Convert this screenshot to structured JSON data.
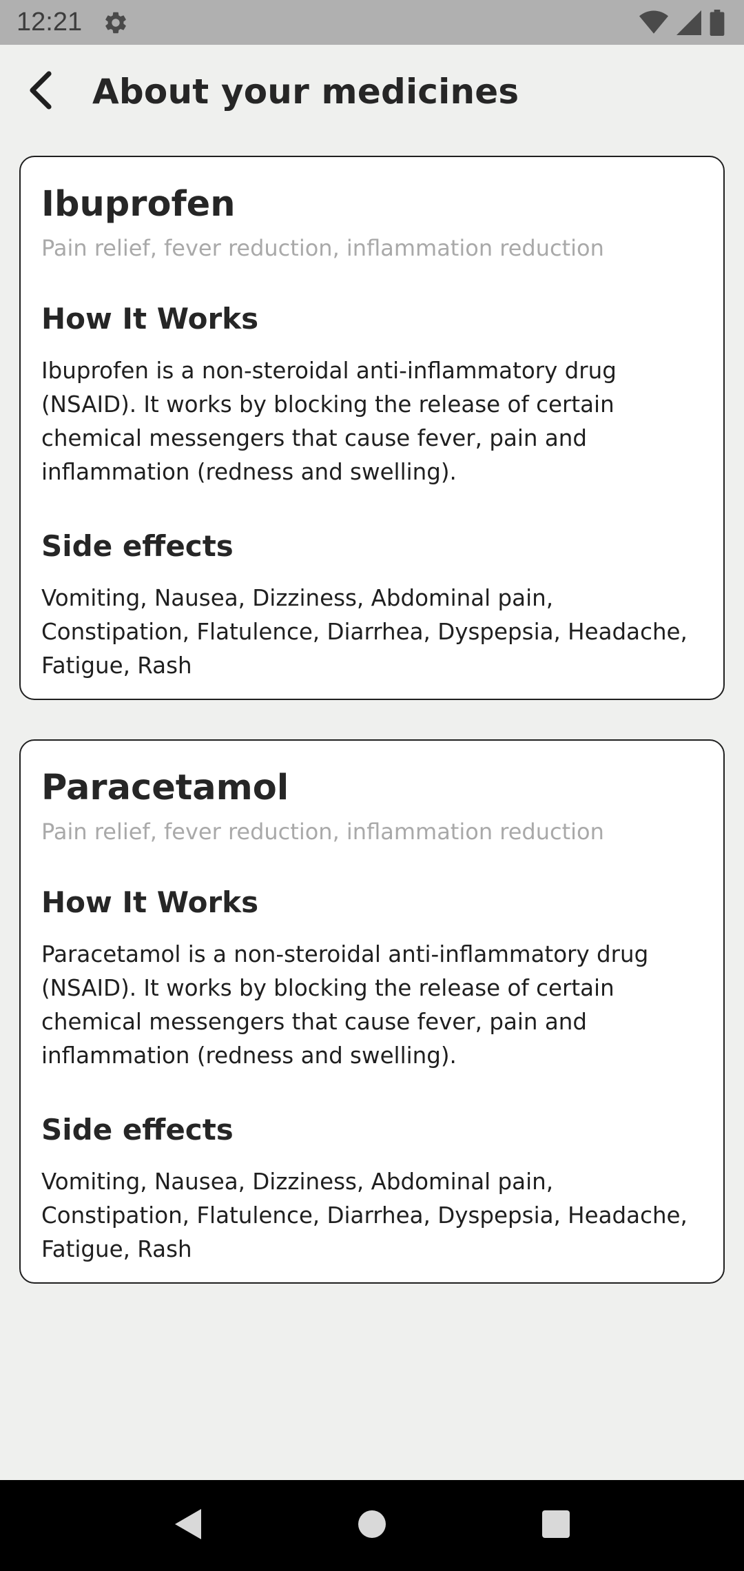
{
  "status_bar": {
    "time": "12:21",
    "icons": [
      "gear-icon",
      "wifi-icon",
      "signal-icon",
      "battery-icon"
    ]
  },
  "app_bar": {
    "title": "About your medicines",
    "back_icon": "chevron-left-icon"
  },
  "medicines": [
    {
      "name": "Ibuprofen",
      "uses": "Pain relief, fever reduction, inflammation reduction",
      "how_title": "How It Works",
      "how_text": "Ibuprofen is a non-steroidal anti-inflammatory drug (NSAID). It works by blocking the release of certain chemical messengers that cause fever, pain and inflammation (redness and swelling).",
      "side_title": "Side effects",
      "side_text": "Vomiting, Nausea, Dizziness, Abdominal pain, Constipation, Flatulence, Diarrhea, Dyspepsia, Headache, Fatigue, Rash"
    },
    {
      "name": "Paracetamol",
      "uses": "Pain relief, fever reduction, inflammation reduction",
      "how_title": "How It Works",
      "how_text": "Paracetamol is a non-steroidal anti-inflammatory drug (NSAID). It works by blocking the release of certain chemical messengers that cause fever, pain and inflammation (redness and swelling).",
      "side_title": "Side effects",
      "side_text": "Vomiting, Nausea, Dizziness, Abdominal pain, Constipation, Flatulence, Diarrhea, Dyspepsia, Headache, Fatigue, Rash"
    }
  ],
  "nav_bar": {
    "icons": [
      "back-triangle-icon",
      "home-circle-icon",
      "recents-square-icon"
    ]
  },
  "colors": {
    "background": "#eff0ee",
    "status_bar": "#b0b0b0",
    "text": "#262626",
    "muted_text": "#a9a9a9",
    "card_border": "#1f1f1f"
  }
}
